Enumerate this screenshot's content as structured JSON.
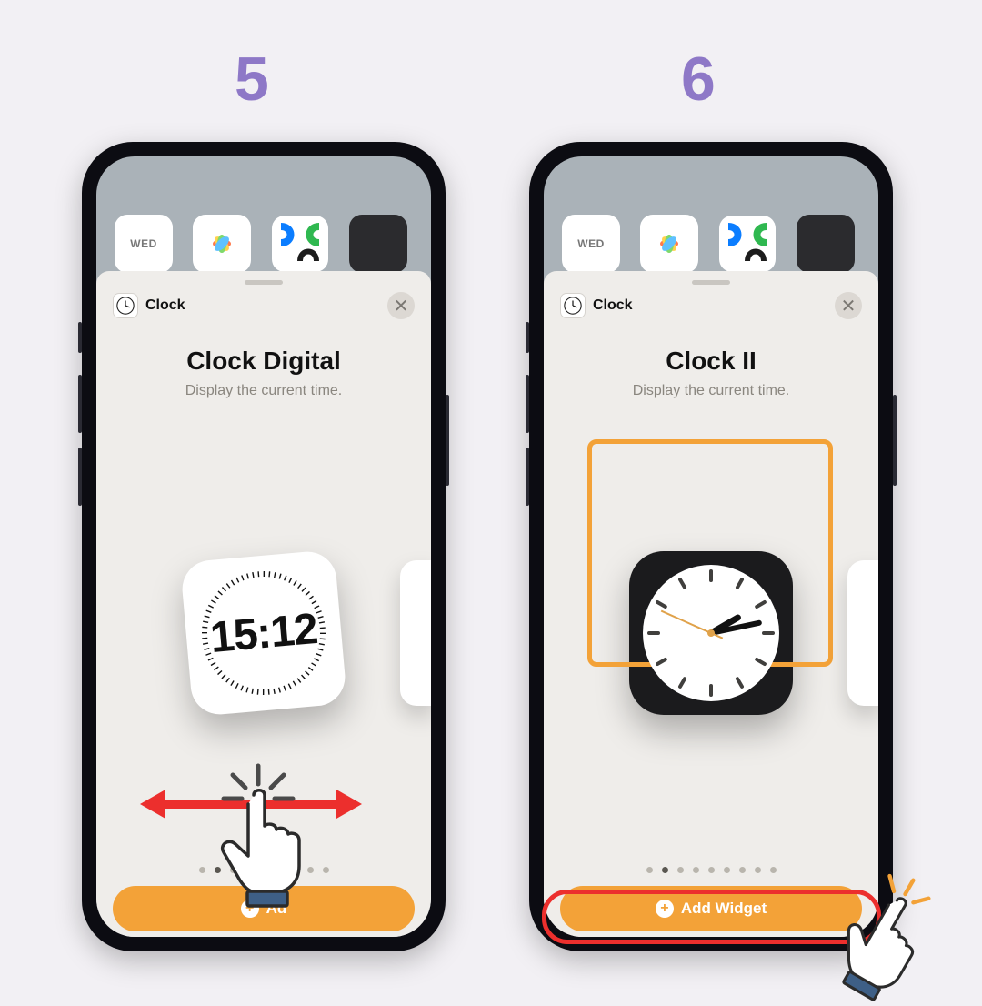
{
  "steps": {
    "left": "5",
    "right": "6"
  },
  "sheet": {
    "app_label": "Clock",
    "close_glyph": "✕",
    "add_label": "Add Widget",
    "add_label_short": "Ad"
  },
  "left_panel": {
    "title": "Clock Digital",
    "subtitle": "Display the current time.",
    "digital_time": "15:12"
  },
  "right_panel": {
    "title": "Clock II",
    "subtitle": "Display the current time."
  },
  "home_row": {
    "day": "WED"
  },
  "page_dots_count": 9,
  "page_dot_active": 1
}
